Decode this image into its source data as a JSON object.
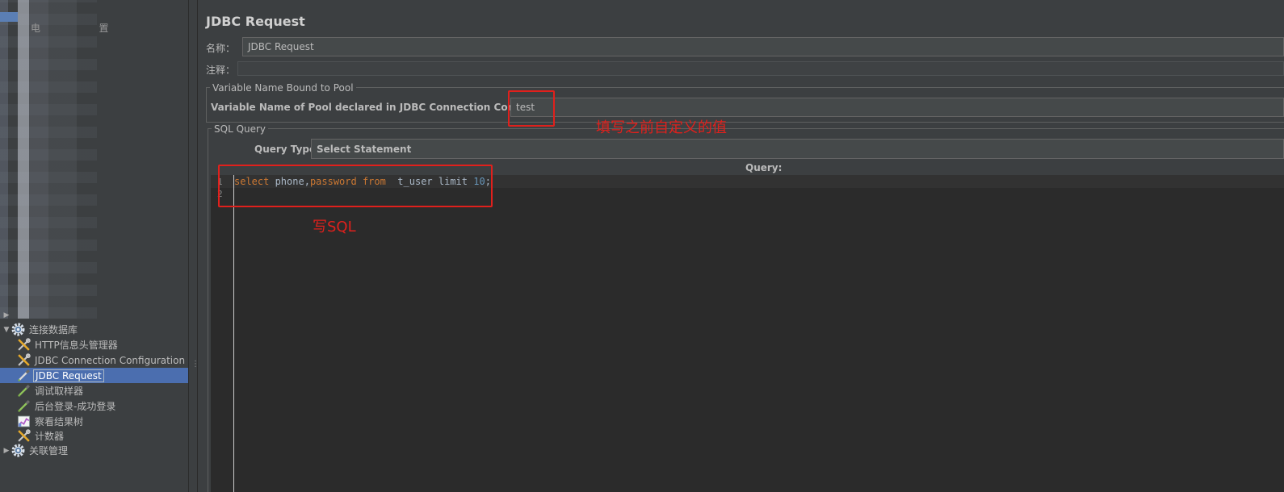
{
  "tree": {
    "items": [
      {
        "label": "连接数据库",
        "icon": "gear-icon",
        "expanded": true
      },
      {
        "label": "HTTP信息头管理器",
        "icon": "config-element-icon"
      },
      {
        "label": "JDBC Connection Configuration",
        "icon": "config-element-icon"
      },
      {
        "label": "JDBC Request",
        "icon": "sampler-pipette-icon",
        "selected": true
      },
      {
        "label": "调试取样器",
        "icon": "sampler-pipette-icon"
      },
      {
        "label": "后台登录-成功登录",
        "icon": "sampler-pipette-icon"
      },
      {
        "label": "察看结果树",
        "icon": "listener-chart-icon"
      },
      {
        "label": "计数器",
        "icon": "config-element-icon"
      },
      {
        "label": "关联管理",
        "icon": "gear-icon",
        "expanded": false
      }
    ],
    "blurred_top_text": "电                   置"
  },
  "panel": {
    "title": "JDBC Request",
    "name_label": "名称：",
    "name_value": "JDBC Request",
    "comment_label": "注释：",
    "comment_value": "",
    "pool_group_title": "Variable Name Bound to Pool",
    "pool_label": "Variable Name of Pool declared in JDBC Connection Configuration:",
    "pool_value": "test",
    "sql_group_title": "SQL Query",
    "query_type_label": "Query Type:",
    "query_type_value": "Select Statement",
    "query_header": "Query:",
    "line_numbers": [
      "1",
      "2"
    ]
  },
  "sql": {
    "kw_select": "select",
    "ident_phone": " phone,",
    "kw_password": "password",
    "kw_from": " from",
    "ident_table": "  t_user limit ",
    "num_limit": "10",
    "semicolon": ";"
  },
  "annotations": {
    "pool_note": "填写之前自定义的值",
    "sql_note": "写SQL",
    "color": "#e0201c"
  },
  "colors": {
    "background": "#3c3f41",
    "selection": "#4b6eaf",
    "editor_bg": "#2b2b2b",
    "keyword": "#cc7832",
    "number": "#6897bb"
  }
}
